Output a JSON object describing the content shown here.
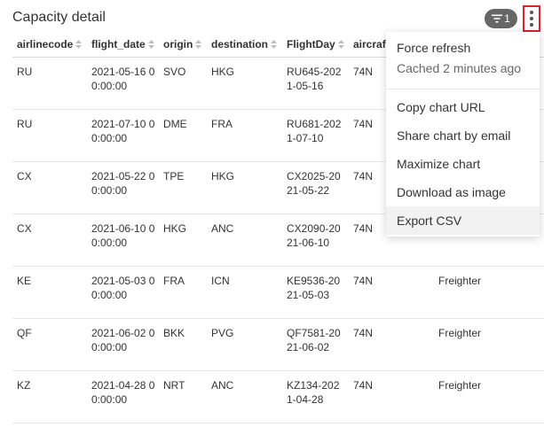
{
  "header": {
    "title": "Capacity detail",
    "filter_count": "1"
  },
  "table": {
    "columns": [
      "airlinecode",
      "flight_date",
      "origin",
      "destination",
      "FlightDay",
      "aircraft",
      ""
    ],
    "rows": [
      [
        "RU",
        "2021-05-16 00:00:00",
        "SVO",
        "HKG",
        "RU645-2021-05-16",
        "74N",
        ""
      ],
      [
        "RU",
        "2021-07-10 00:00:00",
        "DME",
        "FRA",
        "RU681-2021-07-10",
        "74N",
        ""
      ],
      [
        "CX",
        "2021-05-22 00:00:00",
        "TPE",
        "HKG",
        "CX2025-2021-05-22",
        "74N",
        ""
      ],
      [
        "CX",
        "2021-06-10 00:00:00",
        "HKG",
        "ANC",
        "CX2090-2021-06-10",
        "74N",
        ""
      ],
      [
        "KE",
        "2021-05-03 00:00:00",
        "FRA",
        "ICN",
        "KE9536-2021-05-03",
        "74N",
        "Freighter"
      ],
      [
        "QF",
        "2021-06-02 00:00:00",
        "BKK",
        "PVG",
        "QF7581-2021-06-02",
        "74N",
        "Freighter"
      ],
      [
        "KZ",
        "2021-04-28 00:00:00",
        "NRT",
        "ANC",
        "KZ134-2021-04-28",
        "74N",
        "Freighter"
      ]
    ]
  },
  "menu": {
    "force_refresh": "Force refresh",
    "cached": "Cached 2 minutes ago",
    "items": [
      "Copy chart URL",
      "Share chart by email",
      "Maximize chart",
      "Download as image",
      "Export CSV"
    ],
    "hovered": "Export CSV"
  },
  "colors": {
    "badge_bg": "#666666",
    "highlight_border": "#e0202a",
    "menu_hover": "#f2f2f2"
  }
}
